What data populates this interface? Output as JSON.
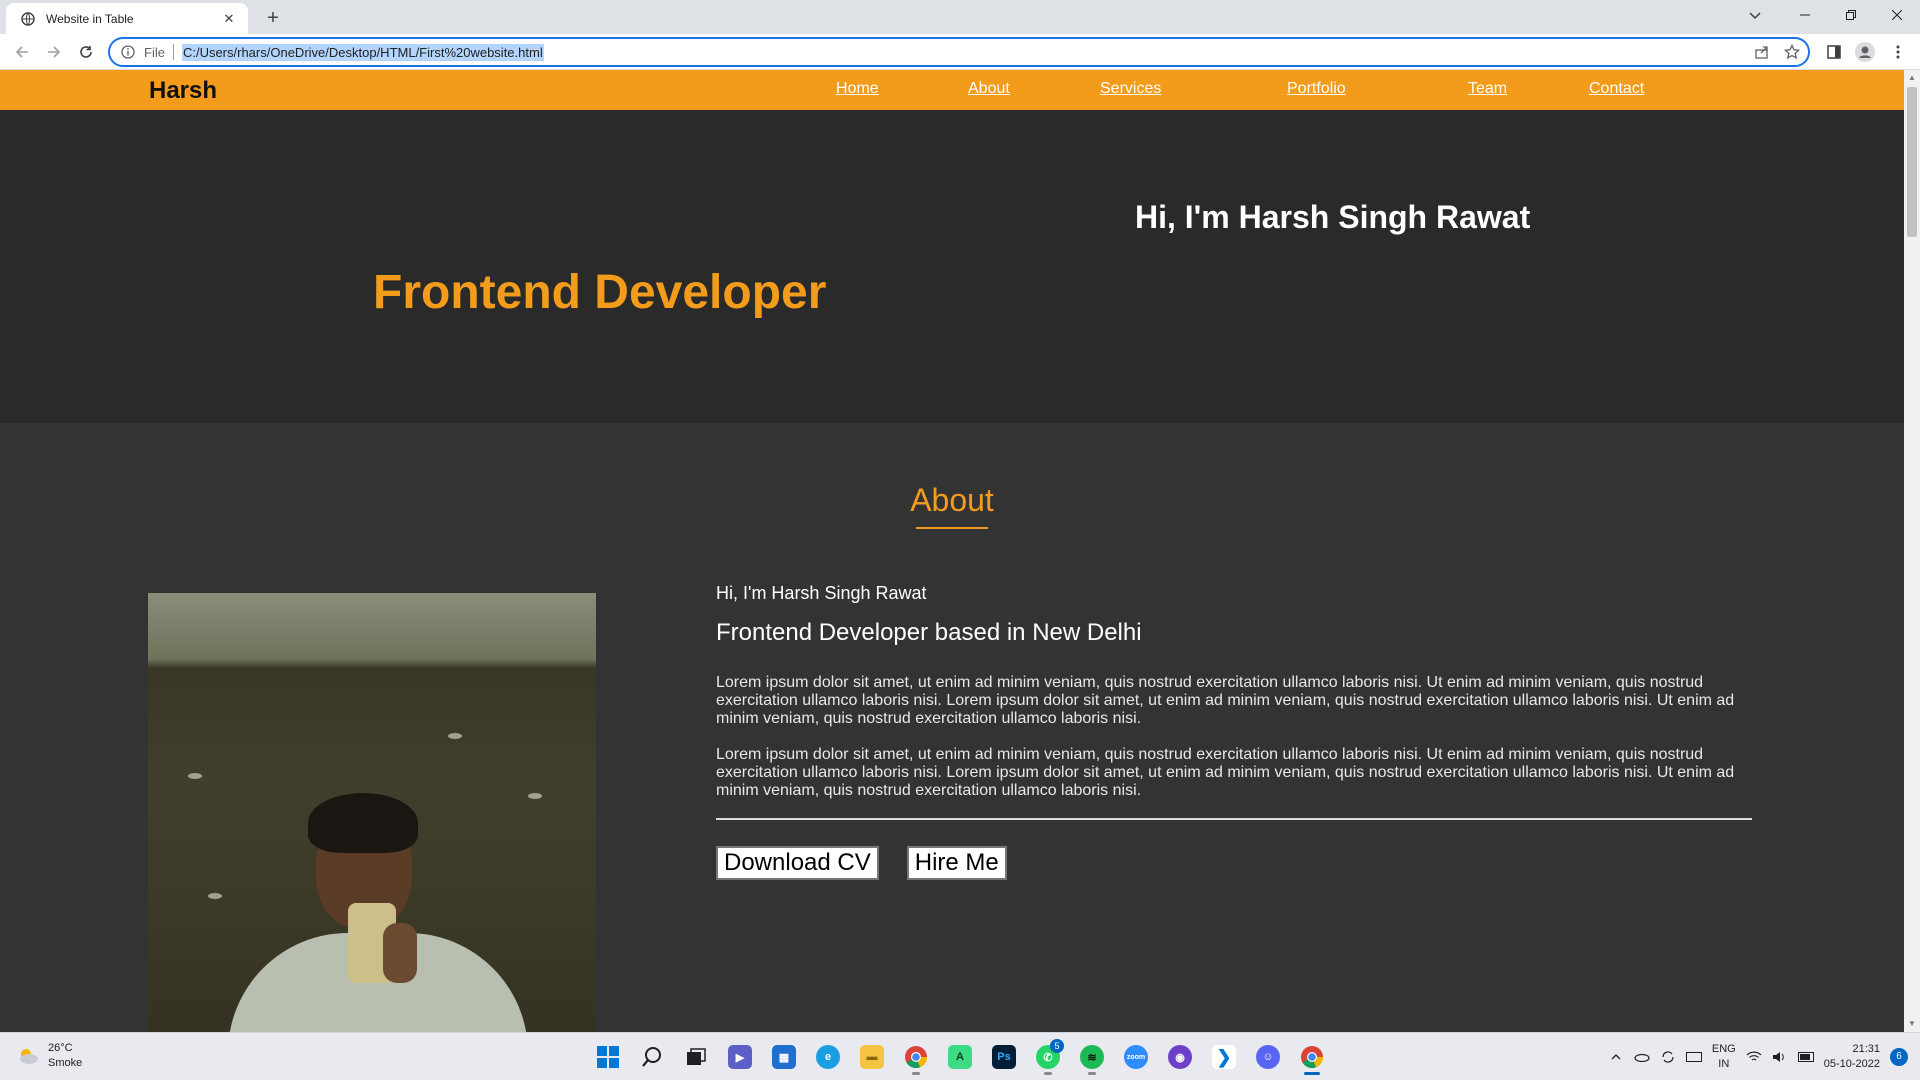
{
  "browser": {
    "tab_title": "Website in Table",
    "tab_close": "✕",
    "new_tab": "+",
    "url_scheme": "File",
    "url": "C:/Users/rhars/OneDrive/Desktop/HTML/First%20website.html"
  },
  "site": {
    "brand": "Harsh",
    "nav": [
      "Home",
      "About",
      "Services",
      "Portfolio",
      "Team",
      "Contact"
    ],
    "hero": {
      "greeting": "Hi, I'm Harsh Singh Rawat",
      "role": "Frontend Developer"
    },
    "about": {
      "title": "About",
      "intro": "Hi, I'm Harsh Singh Rawat",
      "subtitle": "Frontend Developer based in New Delhi",
      "paragraphs": [
        "Lorem ipsum dolor sit amet, ut enim ad minim veniam, quis nostrud exercitation ullamco laboris nisi. Ut enim ad minim veniam, quis nostrud exercitation ullamco laboris nisi. Lorem ipsum dolor sit amet, ut enim ad minim veniam, quis nostrud exercitation ullamco laboris nisi. Ut enim ad minim veniam, quis nostrud exercitation ullamco laboris nisi.",
        "Lorem ipsum dolor sit amet, ut enim ad minim veniam, quis nostrud exercitation ullamco laboris nisi. Ut enim ad minim veniam, quis nostrud exercitation ullamco laboris nisi. Lorem ipsum dolor sit amet, ut enim ad minim veniam, quis nostrud exercitation ullamco laboris nisi. Ut enim ad minim veniam, quis nostrud exercitation ullamco laboris nisi."
      ],
      "buttons": [
        "Download CV",
        "Hire Me"
      ]
    }
  },
  "taskbar": {
    "weather_temp": "26°C",
    "weather_desc": "Smoke",
    "whatsapp_badge": "5",
    "lang_line1": "ENG",
    "lang_line2": "IN",
    "time": "21:31",
    "date": "05-10-2022",
    "notification_count": "6",
    "apps": [
      "start-icon",
      "search-icon",
      "task-view-icon",
      "teams-chat-icon",
      "store-icon",
      "edge-icon",
      "file-explorer-icon",
      "chrome-icon",
      "android-studio-icon",
      "photoshop-icon",
      "whatsapp-icon",
      "spotify-icon",
      "zoom-icon",
      "github-icon",
      "vscode-icon",
      "discord-icon",
      "chrome-active-icon"
    ]
  },
  "colors": {
    "accent": "#f39c1c",
    "hero_bg": "#2a2a2a",
    "about_bg": "#333333",
    "browser_focus": "#1a73e8"
  }
}
